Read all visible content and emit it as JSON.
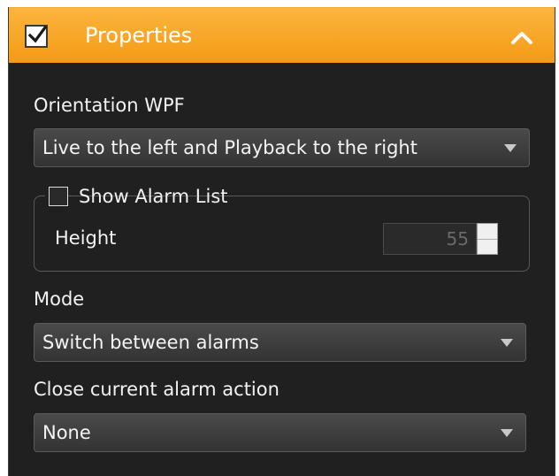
{
  "header": {
    "checked": true,
    "title": "Properties",
    "collapse_icon": "chevron-up-icon"
  },
  "orientation": {
    "label": "Orientation WPF",
    "value": "Live to the left and Playback to the right"
  },
  "alarm_list": {
    "checkbox_label": "Show Alarm List",
    "checked": false,
    "height_label": "Height",
    "height_value": "55"
  },
  "mode": {
    "label": "Mode",
    "value": "Switch between alarms"
  },
  "close_action": {
    "label": "Close current alarm action",
    "value": "None"
  },
  "colors": {
    "header": "#f7a525",
    "panel": "#202020"
  }
}
